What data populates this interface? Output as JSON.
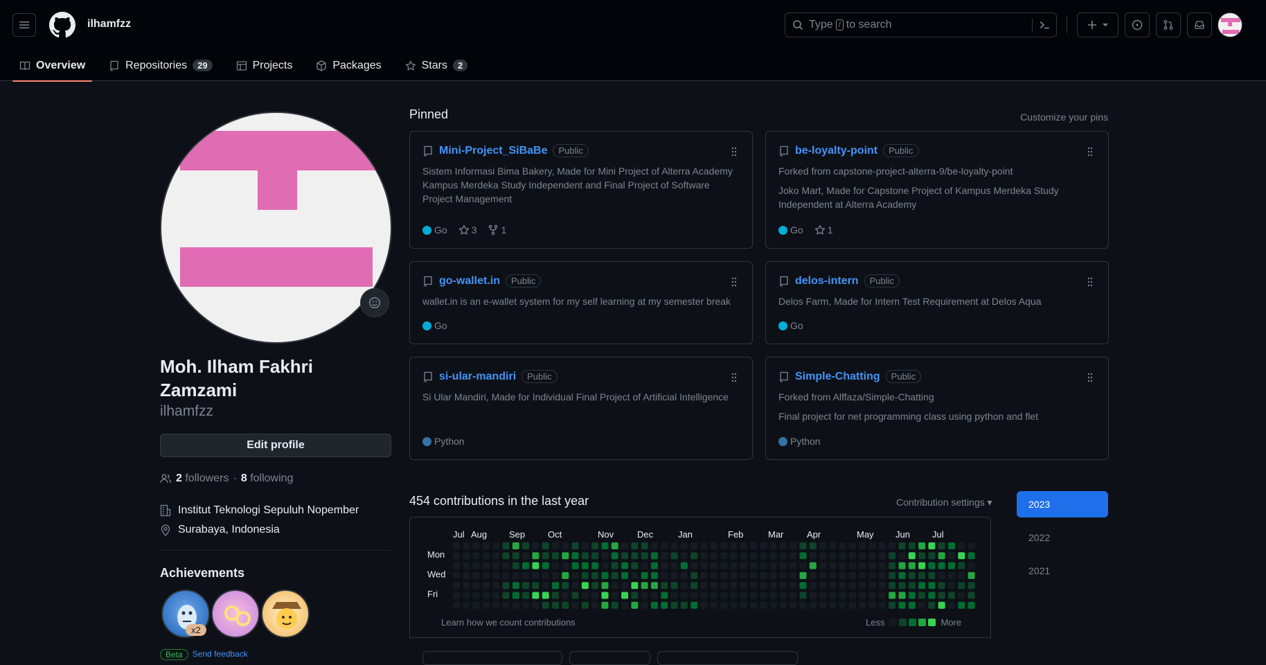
{
  "header": {
    "username": "ilhamfzz",
    "search_placeholder_pre": "Type",
    "search_key": "/",
    "search_placeholder_post": "to search"
  },
  "tabs": [
    {
      "label": "Overview"
    },
    {
      "label": "Repositories",
      "count": "29"
    },
    {
      "label": "Projects"
    },
    {
      "label": "Packages"
    },
    {
      "label": "Stars",
      "count": "2"
    }
  ],
  "profile": {
    "fullname": "Moh. Ilham Fakhri Zamzami",
    "login": "ilhamfzz",
    "edit_label": "Edit profile",
    "followers_count": "2",
    "followers_label": "followers",
    "sep": "·",
    "following_count": "8",
    "following_label": "following",
    "organization": "Institut Teknologi Sepuluh Nopember",
    "location": "Surabaya, Indonesia",
    "achievements_title": "Achievements",
    "achievement_multiplier": "x2",
    "beta_label": "Beta",
    "feedback_label": "Send feedback"
  },
  "pinned": {
    "title": "Pinned",
    "customize": "Customize your pins",
    "repos": [
      {
        "name": "Mini-Project_SiBaBe",
        "visibility": "Public",
        "desc": "Sistem Informasi Bima Bakery, Made for Mini Project of Alterra Academy Kampus Merdeka Study Independent and Final Project of Software Project Management",
        "forked": "",
        "lang": "Go",
        "lang_color": "#00ADD8",
        "stars": "3",
        "forks": "1"
      },
      {
        "name": "be-loyalty-point",
        "visibility": "Public",
        "forked": "Forked from capstone-project-alterra-9/be-loyalty-point",
        "desc": "Joko Mart, Made for Capstone Project of Kampus Merdeka Study Independent at Alterra Academy",
        "lang": "Go",
        "lang_color": "#00ADD8",
        "stars": "1",
        "forks": ""
      },
      {
        "name": "go-wallet.in",
        "visibility": "Public",
        "desc": "wallet.in is an e-wallet system for my self learning at my semester break",
        "forked": "",
        "lang": "Go",
        "lang_color": "#00ADD8",
        "stars": "",
        "forks": ""
      },
      {
        "name": "delos-intern",
        "visibility": "Public",
        "desc": "Delos Farm, Made for Intern Test Requirement at Delos Aqua",
        "forked": "",
        "lang": "Go",
        "lang_color": "#00ADD8",
        "stars": "",
        "forks": ""
      },
      {
        "name": "si-ular-mandiri",
        "visibility": "Public",
        "desc": "Si Ular Mandiri, Made for Individual Final Project of Artificial Intelligence",
        "forked": "",
        "lang": "Python",
        "lang_color": "#3572A5",
        "stars": "",
        "forks": ""
      },
      {
        "name": "Simple-Chatting",
        "visibility": "Public",
        "forked": "Forked from Alffaza/Simple-Chatting",
        "desc": "Final project for net programming class using python and flet",
        "lang": "Python",
        "lang_color": "#3572A5",
        "stars": "",
        "forks": ""
      }
    ]
  },
  "contributions": {
    "title": "454 contributions in the last year",
    "settings": "Contribution settings",
    "months": [
      "Jul",
      "Aug",
      "Sep",
      "Oct",
      "Nov",
      "Dec",
      "Jan",
      "Feb",
      "Mar",
      "Apr",
      "May",
      "Jun",
      "Jul"
    ],
    "days": [
      "Mon",
      "Wed",
      "Fri"
    ],
    "learn": "Learn how we count contributions",
    "less": "Less",
    "more": "More",
    "years": [
      "2023",
      "2022",
      "2021"
    ],
    "level_colors": [
      "#161b22",
      "#0e4429",
      "#006d32",
      "#26a641",
      "#39d353"
    ]
  }
}
